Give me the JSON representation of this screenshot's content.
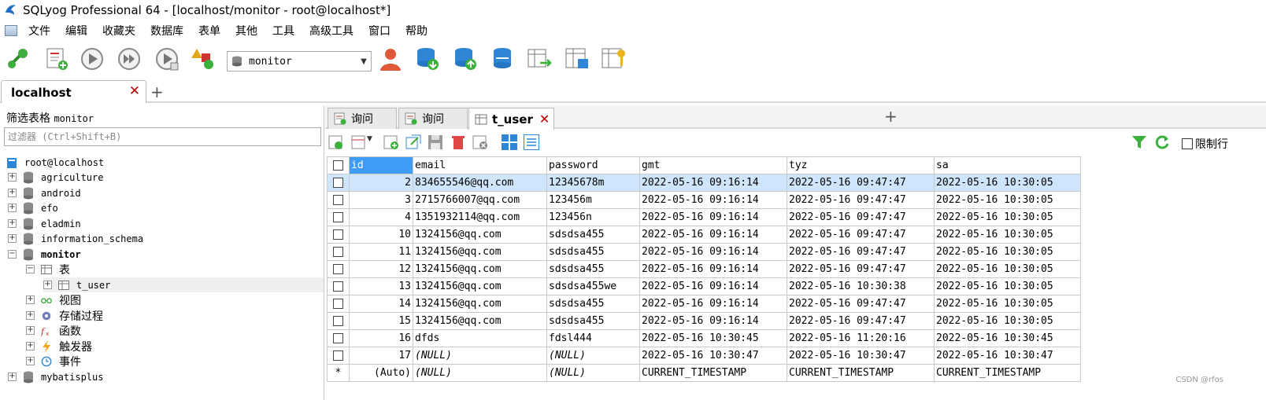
{
  "window": {
    "title": "SQLyog Professional 64 - [localhost/monitor - root@localhost*]"
  },
  "menu": [
    "文件",
    "编辑",
    "收藏夹",
    "数据库",
    "表单",
    "其他",
    "工具",
    "高级工具",
    "窗口",
    "帮助"
  ],
  "toolbar": {
    "database_select": "monitor"
  },
  "connection_tab": {
    "label": "localhost"
  },
  "left_panel": {
    "filter_label": "筛选表格",
    "filter_db": "monitor",
    "filter_placeholder": "过滤器 (Ctrl+Shift+B)",
    "tree": {
      "root": "root@localhost",
      "databases": [
        "agriculture",
        "android",
        "efo",
        "eladmin",
        "information_schema",
        "monitor",
        "mybatisplus"
      ],
      "tables_folder": "表",
      "table": "t_user",
      "views": "视图",
      "procedures": "存储过程",
      "functions": "函数",
      "triggers": "触发器",
      "events": "事件"
    }
  },
  "query_tabs": [
    "询问",
    "询问",
    "t_user"
  ],
  "grid_toolbar": {
    "limit_label": "限制行"
  },
  "grid": {
    "columns": [
      "id",
      "email",
      "password",
      "gmt",
      "tyz",
      "sa"
    ],
    "rows": [
      [
        "2",
        "834655546@qq.com",
        "12345678m",
        "2022-05-16 09:16:14",
        "2022-05-16 09:47:47",
        "2022-05-16 10:30:05"
      ],
      [
        "3",
        "2715766007@qq.com",
        "123456m",
        "2022-05-16 09:16:14",
        "2022-05-16 09:47:47",
        "2022-05-16 10:30:05"
      ],
      [
        "4",
        "1351932114@qq.com",
        "123456n",
        "2022-05-16 09:16:14",
        "2022-05-16 09:47:47",
        "2022-05-16 10:30:05"
      ],
      [
        "10",
        "1324156@qq.com",
        "sdsdsa455",
        "2022-05-16 09:16:14",
        "2022-05-16 09:47:47",
        "2022-05-16 10:30:05"
      ],
      [
        "11",
        "1324156@qq.com",
        "sdsdsa455",
        "2022-05-16 09:16:14",
        "2022-05-16 09:47:47",
        "2022-05-16 10:30:05"
      ],
      [
        "12",
        "1324156@qq.com",
        "sdsdsa455",
        "2022-05-16 09:16:14",
        "2022-05-16 09:47:47",
        "2022-05-16 10:30:05"
      ],
      [
        "13",
        "1324156@qq.com",
        "sdsdsa455we",
        "2022-05-16 09:16:14",
        "2022-05-16 10:30:38",
        "2022-05-16 10:30:05"
      ],
      [
        "14",
        "1324156@qq.com",
        "sdsdsa455",
        "2022-05-16 09:16:14",
        "2022-05-16 09:47:47",
        "2022-05-16 10:30:05"
      ],
      [
        "15",
        "1324156@qq.com",
        "sdsdsa455",
        "2022-05-16 09:16:14",
        "2022-05-16 09:47:47",
        "2022-05-16 10:30:05"
      ],
      [
        "16",
        "dfds",
        "fdsl444",
        "2022-05-16 10:30:45",
        "2022-05-16 11:20:16",
        "2022-05-16 10:30:45"
      ],
      [
        "17",
        "(NULL)",
        "(NULL)",
        "2022-05-16 10:30:47",
        "2022-05-16 10:30:47",
        "2022-05-16 10:30:47"
      ]
    ],
    "new_row": [
      "*",
      "(Auto)",
      "(NULL)",
      "(NULL)",
      "CURRENT_TIMESTAMP",
      "CURRENT_TIMESTAMP",
      "CURRENT_TIMESTAMP"
    ]
  },
  "watermark": "CSDN @rfos"
}
